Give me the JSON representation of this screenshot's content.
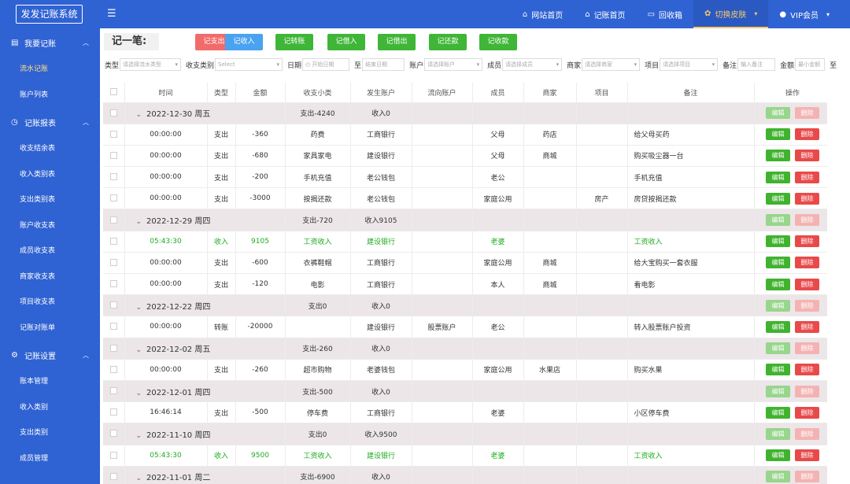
{
  "app": {
    "title": "发发记账系统"
  },
  "topnav": [
    {
      "label": "网站首页",
      "icon": "home-icon"
    },
    {
      "label": "记账首页",
      "icon": "home-icon"
    },
    {
      "label": "回收箱",
      "icon": "trash-icon"
    },
    {
      "label": "切换皮肤",
      "icon": "palette-icon"
    },
    {
      "label": "VIP会员",
      "icon": "user-icon"
    }
  ],
  "sidebar": {
    "groups": [
      {
        "label": "我要记账",
        "items": [
          "流水记账",
          "账户列表"
        ]
      },
      {
        "label": "记账报表",
        "items": [
          "收支结余表",
          "收入类别表",
          "支出类别表",
          "账户收支表",
          "成员收支表",
          "商家收支表",
          "项目收支表",
          "记账对账单"
        ]
      },
      {
        "label": "记账设置",
        "items": [
          "账本管理",
          "收入类别",
          "支出类别",
          "成员管理"
        ]
      }
    ],
    "active": "流水记账"
  },
  "toolbar": {
    "title": "记一笔:",
    "buttons": [
      {
        "label": "记支出",
        "color": "#f26b6b"
      },
      {
        "label": "记收入",
        "color": "#4aa3f0"
      },
      {
        "label": "记转账",
        "color": "#3fb637"
      },
      {
        "label": "记借入",
        "color": "#3fb637"
      },
      {
        "label": "记借出",
        "color": "#3fb637"
      },
      {
        "label": "记还款",
        "color": "#3fb637"
      },
      {
        "label": "记收款",
        "color": "#3fb637"
      }
    ]
  },
  "filters": {
    "type": {
      "label": "类型",
      "placeholder": "请选择流水类型"
    },
    "category": {
      "label": "收支类别",
      "placeholder": "Select"
    },
    "date": {
      "label": "日期",
      "start": "开始日期",
      "sep": "至",
      "end": "结束日期"
    },
    "account": {
      "label": "账户",
      "placeholder": "请选择账户"
    },
    "member": {
      "label": "成员",
      "placeholder": "请选择成员"
    },
    "merchant": {
      "label": "商家",
      "placeholder": "请选择商家"
    },
    "project": {
      "label": "项目",
      "placeholder": "请选择项目"
    },
    "memo": {
      "label": "备注",
      "placeholder": "输入备注"
    },
    "amount": {
      "label": "金额",
      "placeholder": "最小金额",
      "sep": "至"
    }
  },
  "table": {
    "headers": [
      "时间",
      "类型",
      "金额",
      "收支小类",
      "发生账户",
      "流向账户",
      "成员",
      "商家",
      "项目",
      "备注",
      "操作"
    ],
    "edit_label": "编辑",
    "delete_label": "删除",
    "groups": [
      {
        "date": "2022-12-30 周五",
        "expense": "支出-4240",
        "income": "收入0",
        "rows": [
          [
            "00:00:00",
            "支出",
            "-360",
            "药费",
            "工商银行",
            "",
            "父母",
            "药店",
            "",
            "给父母买药"
          ],
          [
            "00:00:00",
            "支出",
            "-680",
            "家具家电",
            "建设银行",
            "",
            "父母",
            "商城",
            "",
            "购买吸尘器一台"
          ],
          [
            "00:00:00",
            "支出",
            "-200",
            "手机充值",
            "老公钱包",
            "",
            "老公",
            "",
            "",
            "手机充值"
          ],
          [
            "00:00:00",
            "支出",
            "-3000",
            "按揭还款",
            "老公钱包",
            "",
            "家庭公用",
            "",
            "房产",
            "房贷按揭还款"
          ]
        ]
      },
      {
        "date": "2022-12-29 周四",
        "expense": "支出-720",
        "income": "收入9105",
        "rows": [
          [
            "05:43:30",
            "收入",
            "9105",
            "工资收入",
            "建设银行",
            "",
            "老婆",
            "",
            "",
            "工资收入"
          ],
          [
            "00:00:00",
            "支出",
            "-600",
            "衣裤鞋帽",
            "工商银行",
            "",
            "家庭公用",
            "商城",
            "",
            "给大宝购买一套衣服"
          ],
          [
            "00:00:00",
            "支出",
            "-120",
            "电影",
            "工商银行",
            "",
            "本人",
            "商城",
            "",
            "看电影"
          ]
        ]
      },
      {
        "date": "2022-12-22 周四",
        "expense": "支出0",
        "income": "收入0",
        "rows": [
          [
            "00:00:00",
            "转账",
            "-20000",
            "",
            "建设银行",
            "股票账户",
            "老公",
            "",
            "",
            "转入股票账户投资"
          ]
        ]
      },
      {
        "date": "2022-12-02 周五",
        "expense": "支出-260",
        "income": "收入0",
        "rows": [
          [
            "00:00:00",
            "支出",
            "-260",
            "超市购物",
            "老婆钱包",
            "",
            "家庭公用",
            "水果店",
            "",
            "购买水果"
          ]
        ]
      },
      {
        "date": "2022-12-01 周四",
        "expense": "支出-500",
        "income": "收入0",
        "rows": [
          [
            "16:46:14",
            "支出",
            "-500",
            "停车费",
            "工商银行",
            "",
            "老婆",
            "",
            "",
            "小区停车费"
          ]
        ]
      },
      {
        "date": "2022-11-10 周四",
        "expense": "支出0",
        "income": "收入9500",
        "rows": [
          [
            "05:43:30",
            "收入",
            "9500",
            "工资收入",
            "建设银行",
            "",
            "老婆",
            "",
            "",
            "工资收入"
          ]
        ]
      },
      {
        "date": "2022-11-01 周二",
        "expense": "支出-6900",
        "income": "收入0",
        "rows": []
      }
    ]
  }
}
